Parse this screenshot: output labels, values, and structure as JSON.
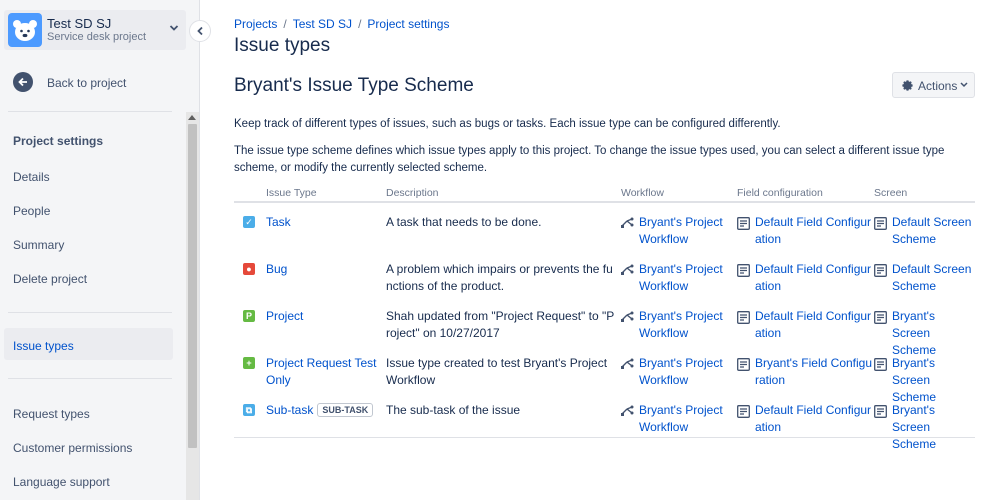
{
  "project": {
    "name": "Test SD SJ",
    "type": "Service desk project"
  },
  "sidebar": {
    "back_label": "Back to project",
    "settings_heading": "Project settings",
    "items": [
      {
        "label": "Details"
      },
      {
        "label": "People"
      },
      {
        "label": "Summary"
      },
      {
        "label": "Delete project"
      },
      {
        "label": "Issue types"
      },
      {
        "label": "Request types"
      },
      {
        "label": "Customer permissions"
      },
      {
        "label": "Language support"
      }
    ]
  },
  "breadcrumb": [
    "Projects",
    "Test SD SJ",
    "Project settings"
  ],
  "page_title": "Issue types",
  "scheme_title": "Bryant's Issue Type Scheme",
  "actions_label": "Actions",
  "description_1": "Keep track of different types of issues, such as bugs or tasks. Each issue type can be configured differently.",
  "description_2": "The issue type scheme defines which issue types apply to this project. To change the issue types used, you can select a different issue type scheme, or modify the currently selected scheme.",
  "table": {
    "headers": [
      "Issue Type",
      "Description",
      "Workflow",
      "Field configuration",
      "Screen"
    ],
    "rows": [
      {
        "name": "Task",
        "badge": "",
        "desc": "A task that needs to be done.",
        "workflow": "Bryant's Project Workflow",
        "field_config": "Default Field Configuration",
        "screen": "Default Screen Scheme",
        "icon_color": "#4bade8"
      },
      {
        "name": "Bug",
        "badge": "",
        "desc": "A problem which impairs or prevents the functions of the product.",
        "workflow": "Bryant's Project Workflow",
        "field_config": "Default Field Configuration",
        "screen": "Default Screen Scheme",
        "icon_color": "#e5493a"
      },
      {
        "name": "Project",
        "badge": "",
        "desc": "Shah updated from \"Project Request\" to \"Project\" on 10/27/2017",
        "workflow": "Bryant's Project Workflow",
        "field_config": "Default Field Configuration",
        "screen": "Bryant's Screen Scheme",
        "icon_color": "#65ba43"
      },
      {
        "name": "Project Request Test Only",
        "badge": "",
        "desc": "Issue type created to test Bryant's Project Workflow",
        "workflow": "Bryant's Project Workflow",
        "field_config": "Bryant's Field Configuration",
        "screen": "Bryant's Screen Scheme",
        "icon_color": "#65ba43"
      },
      {
        "name": "Sub-task",
        "badge": "SUB-TASK",
        "desc": "The sub-task of the issue",
        "workflow": "Bryant's Project Workflow",
        "field_config": "Default Field Configuration",
        "screen": "Bryant's Screen Scheme",
        "icon_color": "#4bade8"
      }
    ]
  }
}
